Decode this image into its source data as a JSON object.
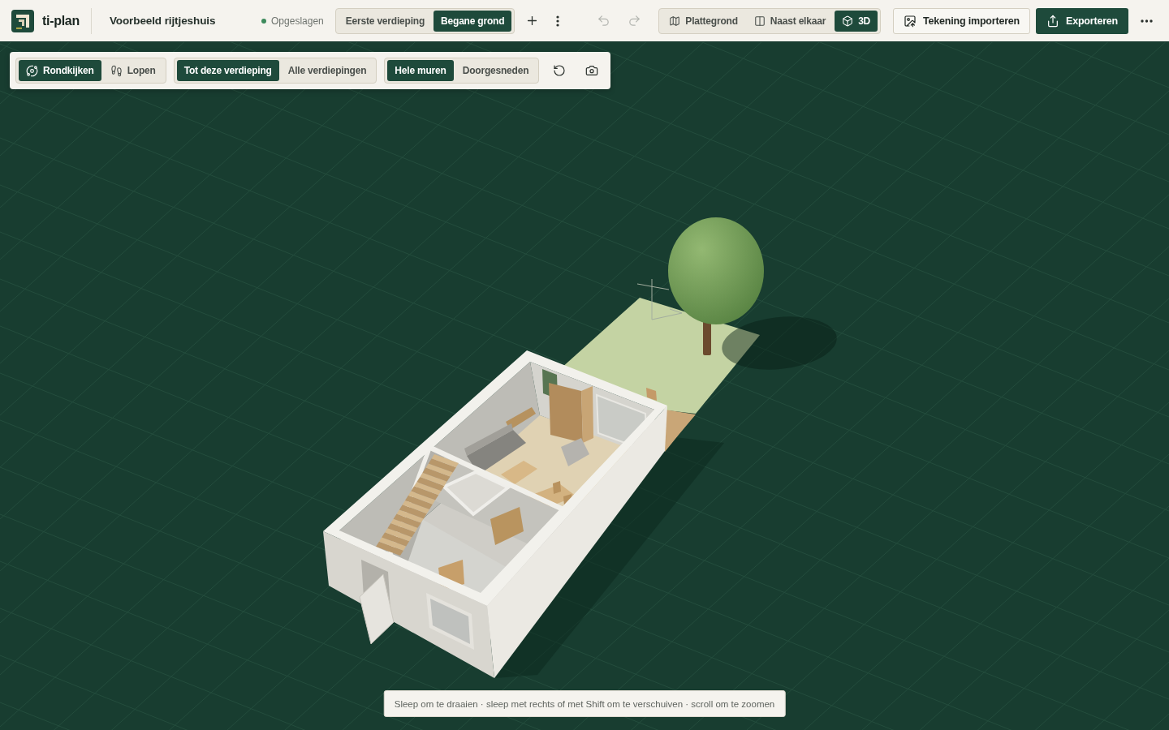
{
  "app": {
    "name": "ti-plan"
  },
  "project": {
    "title": "Voorbeeld rijtjeshuis"
  },
  "save_status": {
    "label": "Opgeslagen",
    "saved": true
  },
  "floors": [
    {
      "label": "Eerste verdieping",
      "selected": false
    },
    {
      "label": "Begane grond",
      "selected": true
    }
  ],
  "history": [
    {
      "kind": "undo",
      "disabled": true
    },
    {
      "kind": "redo",
      "disabled": true
    }
  ],
  "views": [
    {
      "kind": "map",
      "label": "Plattegrond",
      "selected": false
    },
    {
      "kind": "split",
      "label": "Naast elkaar",
      "selected": false
    },
    {
      "kind": "cube",
      "label": "3D",
      "selected": true
    }
  ],
  "actions": [
    {
      "kind": "import",
      "label": "Tekening importeren"
    },
    {
      "kind": "export",
      "label": "Exporteren"
    }
  ],
  "viewer_toolbar": {
    "groups": [
      {
        "options": [
          {
            "kind": "orbit",
            "label": "Rondkijken",
            "selected": true
          },
          {
            "kind": "walk",
            "label": "Lopen",
            "selected": false
          }
        ]
      },
      {
        "options": [
          {
            "kind": "plain",
            "label": "Tot deze verdieping",
            "selected": true
          },
          {
            "kind": "plain",
            "label": "Alle verdiepingen",
            "selected": false
          }
        ]
      },
      {
        "options": [
          {
            "kind": "plain",
            "label": "Hele muren",
            "selected": true
          },
          {
            "kind": "plain",
            "label": "Doorgesneden",
            "selected": false
          }
        ]
      }
    ]
  },
  "hint": "Sleep om te draaien · sleep met rechts of met Shift om te verschuiven · scroll om te zoomen"
}
